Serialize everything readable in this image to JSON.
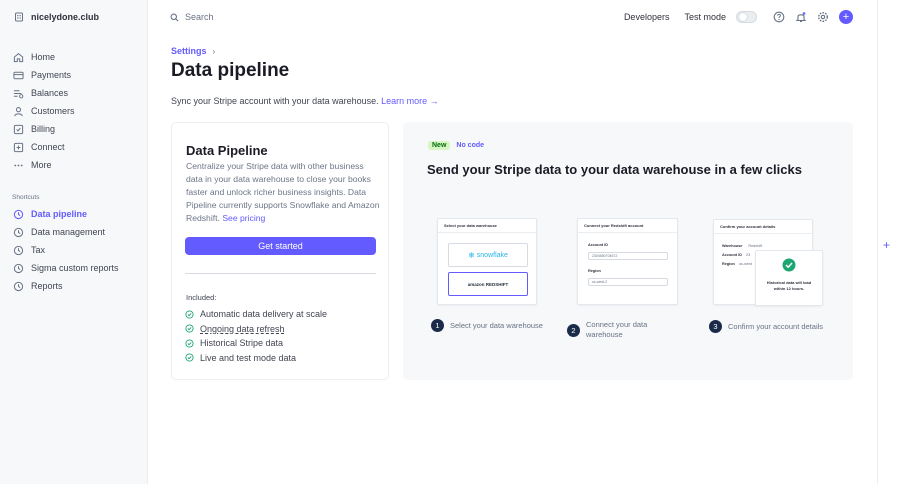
{
  "account": {
    "name": "nicelydone.club"
  },
  "search": {
    "placeholder": "Search"
  },
  "topbar": {
    "developers": "Developers",
    "test_mode": "Test mode"
  },
  "sidebar": {
    "items": [
      {
        "label": "Home",
        "icon": "home-icon"
      },
      {
        "label": "Payments",
        "icon": "payments-icon"
      },
      {
        "label": "Balances",
        "icon": "balances-icon"
      },
      {
        "label": "Customers",
        "icon": "customers-icon"
      },
      {
        "label": "Billing",
        "icon": "billing-icon"
      },
      {
        "label": "Connect",
        "icon": "connect-icon"
      },
      {
        "label": "More",
        "icon": "more-icon"
      }
    ],
    "shortcuts_label": "Shortcuts",
    "shortcuts": [
      {
        "label": "Data pipeline",
        "active": true
      },
      {
        "label": "Data management"
      },
      {
        "label": "Tax"
      },
      {
        "label": "Sigma custom reports"
      },
      {
        "label": "Reports"
      }
    ]
  },
  "breadcrumb": {
    "parent": "Settings"
  },
  "page": {
    "title": "Data pipeline",
    "subtitle": "Sync your Stripe account with your data warehouse.",
    "learn_more": "Learn more →"
  },
  "card": {
    "title": "Data Pipeline",
    "description": "Centralize your Stripe data with other business data in your data warehouse to close your books faster and unlock richer business insights. Data Pipeline currently supports Snowflake and Amazon Redshift.",
    "see_pricing": "See pricing",
    "cta": "Get started",
    "included_label": "Included:",
    "features": [
      "Automatic data delivery at scale",
      "Ongoing data refresh",
      "Historical Stripe data",
      "Live and test mode data"
    ]
  },
  "promo": {
    "badge_new": "New",
    "badge_nocode": "No code",
    "title": "Send your Stripe data to your data warehouse in a few clicks",
    "shot1": {
      "header": "Select your data warehouse",
      "option1": "snowflake",
      "option2": "amazon REDSHIFT"
    },
    "shot2": {
      "header": "Connect your Redshift account",
      "account_label": "Account ID",
      "account_value": "2304650704672",
      "region_label": "Region",
      "region_value": "us-west-2"
    },
    "shot3": {
      "header": "Confirm your account details",
      "warehouse_label": "Warehouse",
      "warehouse_value": "Redshift",
      "account_label": "Account ID",
      "account_value": "23",
      "region_label": "Region",
      "region_value": "us-west",
      "toast": "Historical data will load within 12 hours."
    },
    "steps": [
      {
        "num": "1",
        "text": "Select your data warehouse"
      },
      {
        "num": "2",
        "text": "Connect your data warehouse"
      },
      {
        "num": "3",
        "text": "Confirm your account details"
      }
    ]
  },
  "colors": {
    "accent": "#635bff",
    "success": "#1ea672",
    "badge_bg": "#d7f7c2"
  }
}
